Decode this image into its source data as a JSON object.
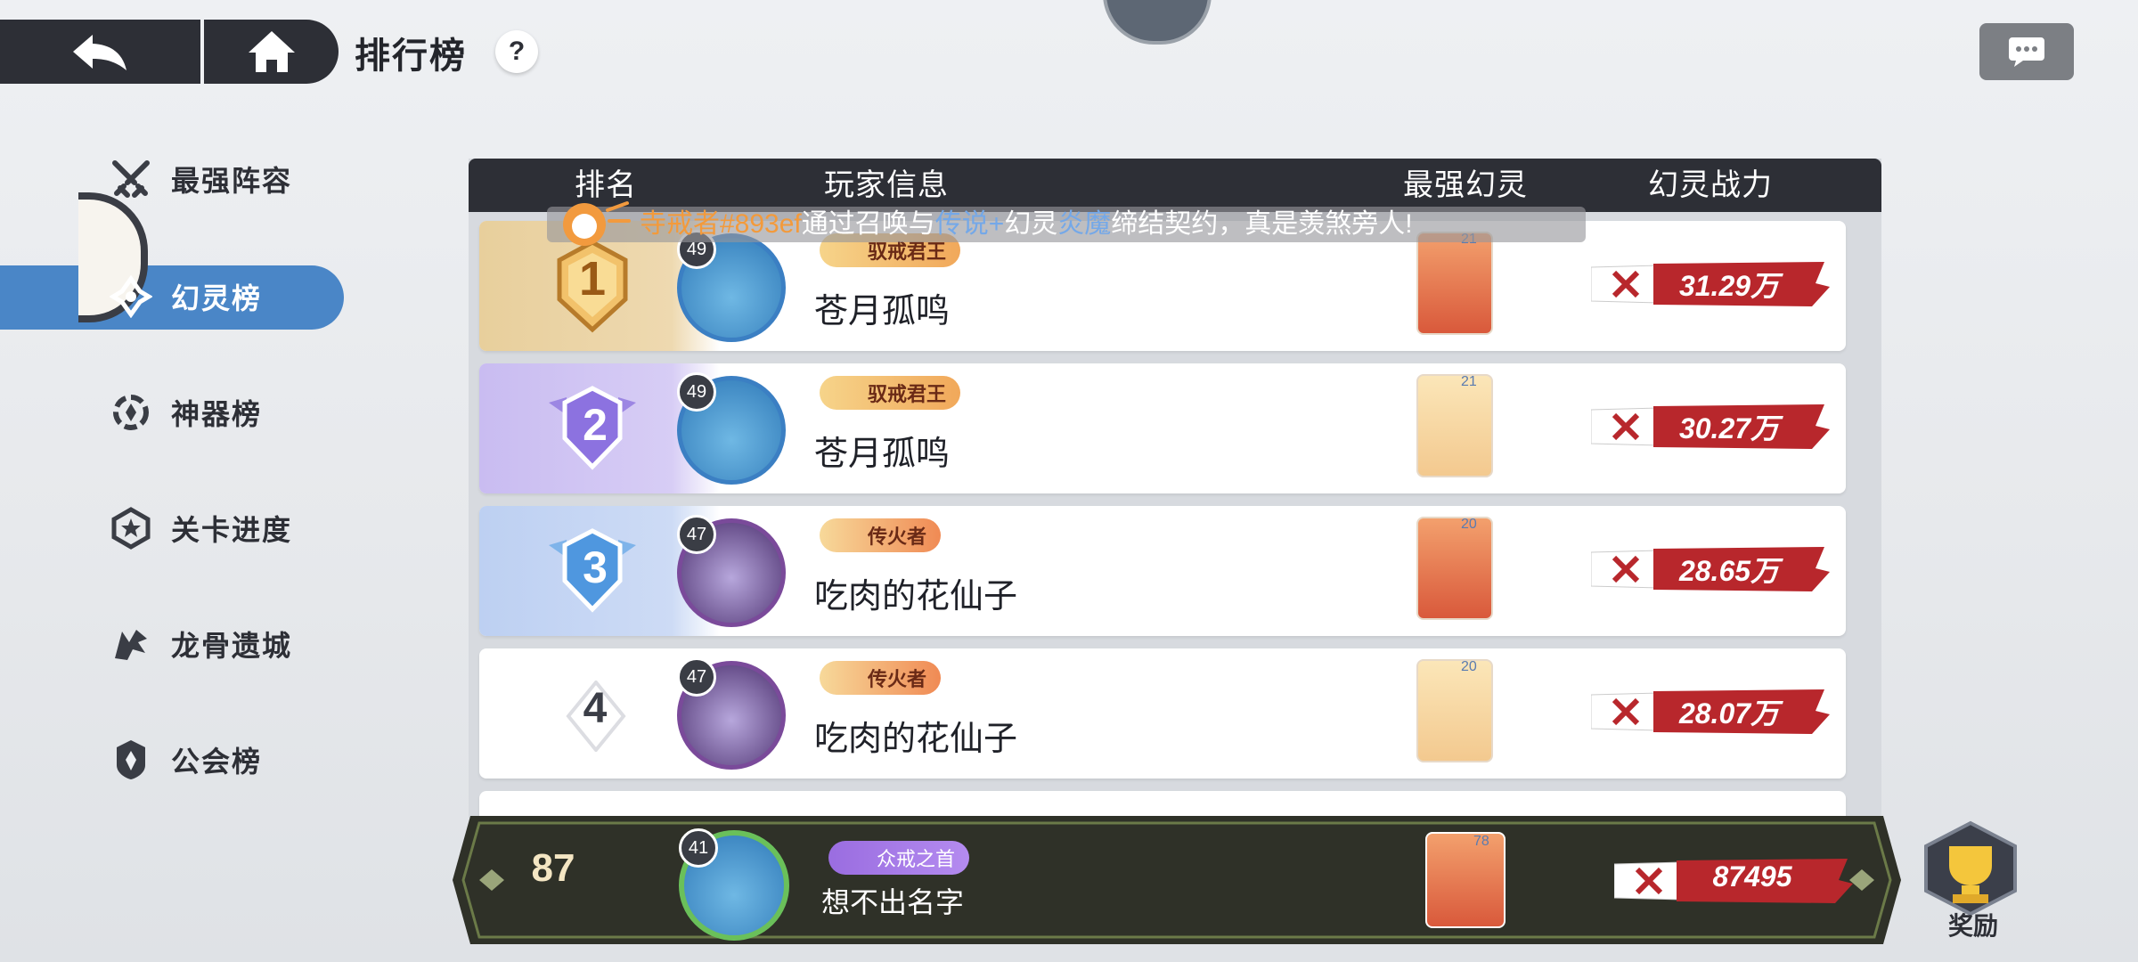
{
  "header": {
    "title": "排行榜",
    "help_label": "?"
  },
  "sidebar": {
    "items": [
      {
        "label": "最强阵容",
        "icon": "crossed-swords-icon"
      },
      {
        "label": "幻灵榜",
        "icon": "spirit-icon",
        "active": true
      },
      {
        "label": "神器榜",
        "icon": "artifact-icon"
      },
      {
        "label": "关卡进度",
        "icon": "star-shield-icon"
      },
      {
        "label": "龙骨遗城",
        "icon": "dragon-icon"
      },
      {
        "label": "公会榜",
        "icon": "guild-icon"
      }
    ]
  },
  "table": {
    "columns": [
      "排名",
      "玩家信息",
      "最强幻灵",
      "幻灵战力"
    ],
    "rows": [
      {
        "rank": "1",
        "level": "49",
        "title": "驭戒君王",
        "name": "苍月孤鸣",
        "spirit_level": "21",
        "power": "31.29万"
      },
      {
        "rank": "2",
        "level": "49",
        "title": "驭戒君王",
        "name": "苍月孤鸣",
        "spirit_level": "21",
        "power": "30.27万"
      },
      {
        "rank": "3",
        "level": "47",
        "title": "传火者",
        "name": "吃肉的花仙子",
        "spirit_level": "20",
        "power": "28.65万"
      },
      {
        "rank": "4",
        "level": "47",
        "title": "传火者",
        "name": "吃肉的花仙子",
        "spirit_level": "20",
        "power": "28.07万"
      }
    ]
  },
  "toast": {
    "player": "寺戒者#893ef",
    "part1": "通过召唤与",
    "quality": "传说+",
    "part2": "幻灵",
    "spirit": "炎魔",
    "part3": "缔结契约，真是羡煞旁人!"
  },
  "my_rank": {
    "rank": "87",
    "level": "41",
    "title": "众戒之首",
    "name": "想不出名字",
    "spirit_level": "78",
    "power": "87495"
  },
  "reward": {
    "label": "奖励"
  },
  "colors": {
    "header_bg": "#2d2f36",
    "active_tab": "#4a86c7",
    "gold": "#e4c48a",
    "purple": "#c7b9ee",
    "blue": "#b7cdf0",
    "power_red": "#b8272c"
  }
}
